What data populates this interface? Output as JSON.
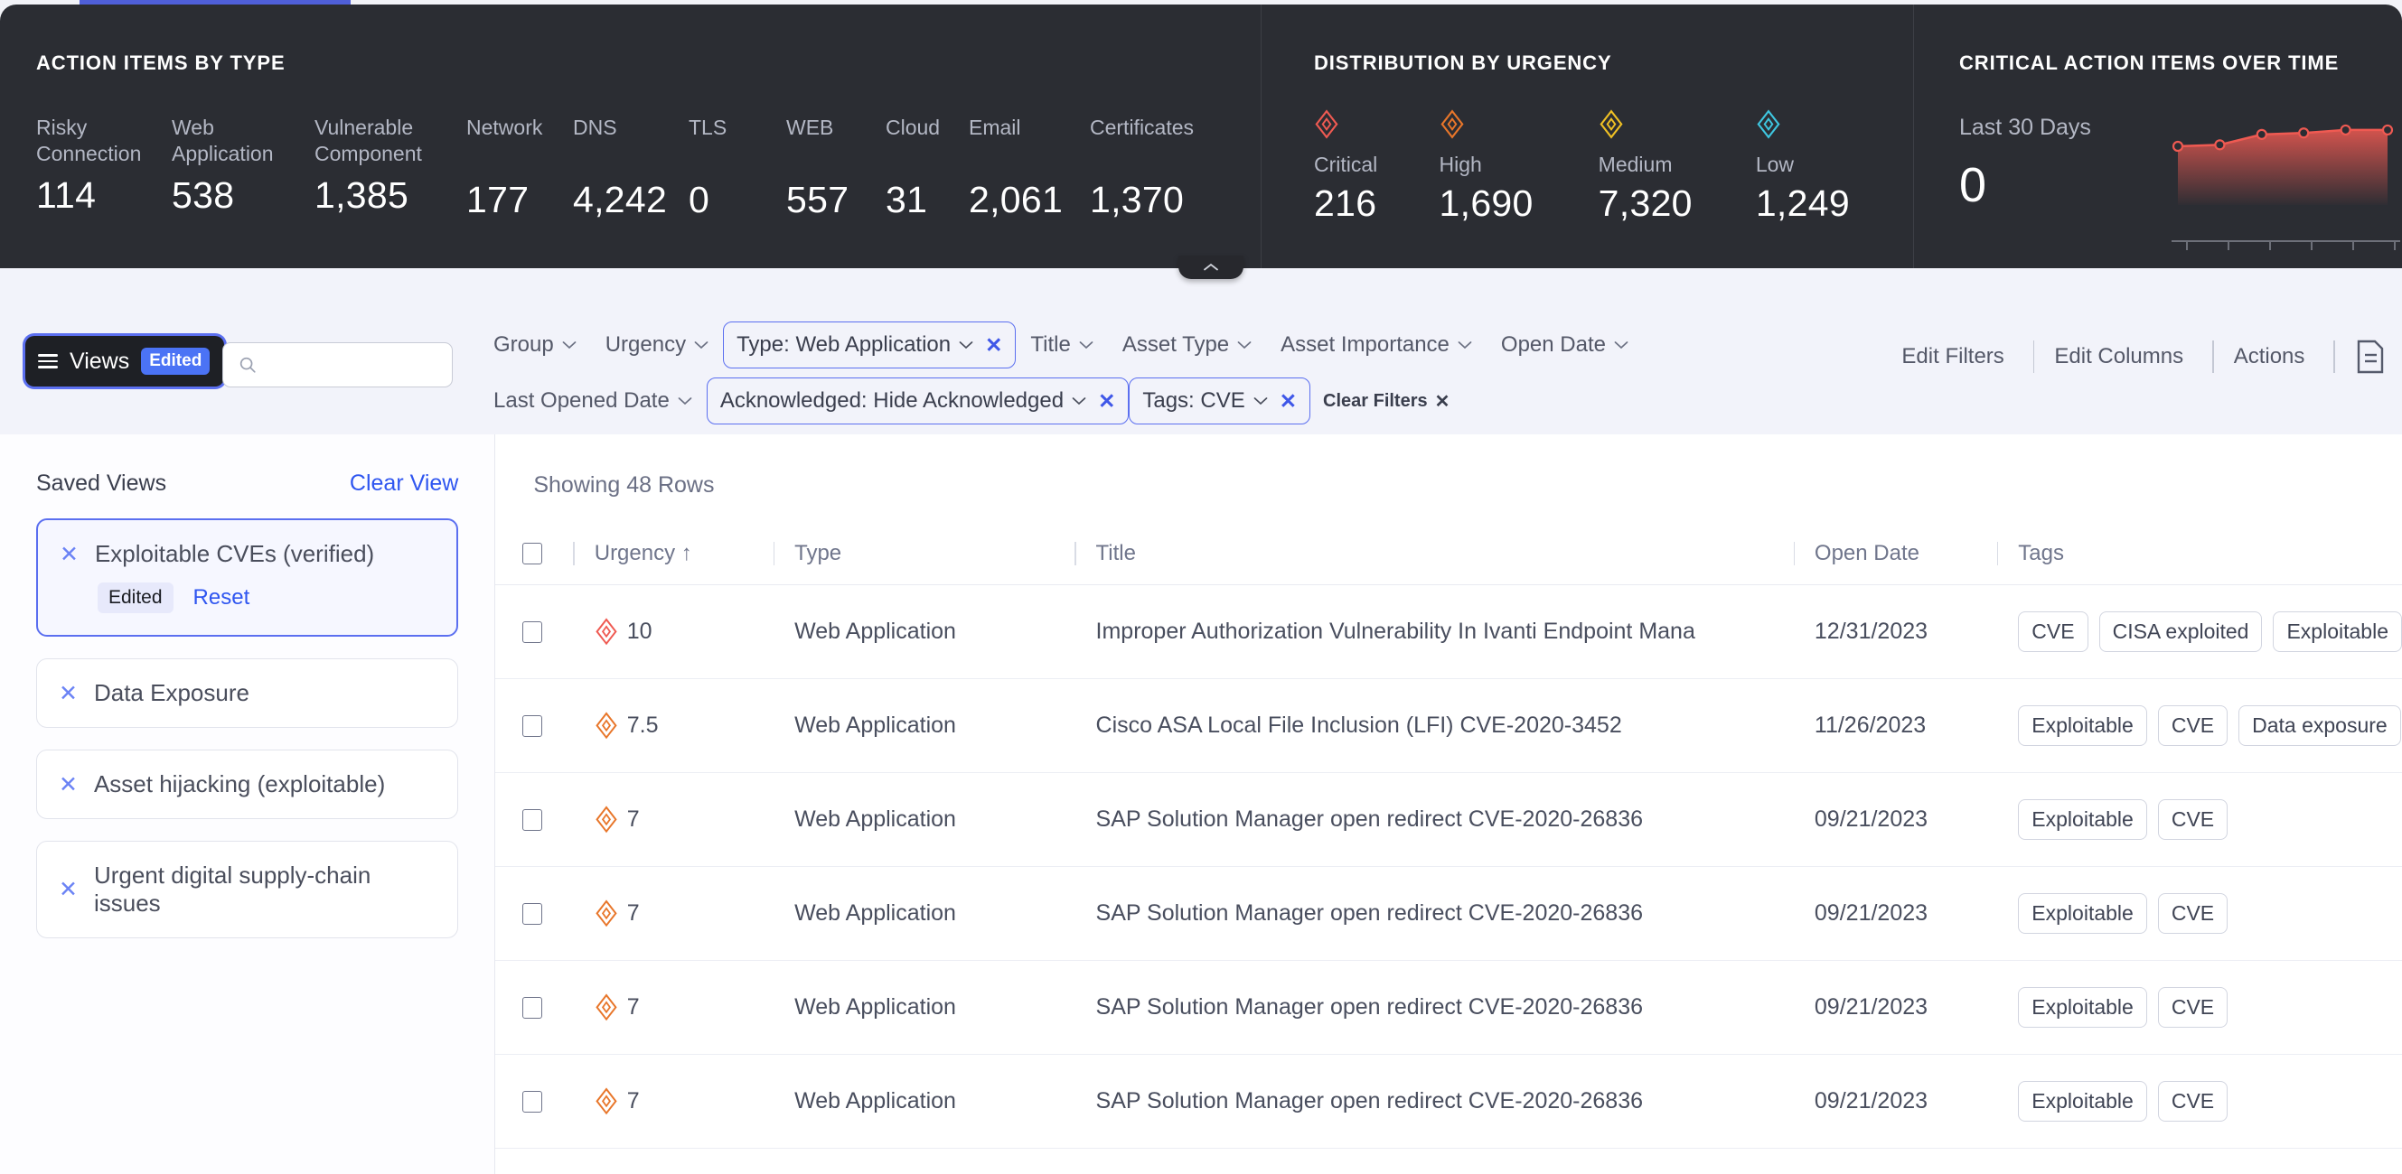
{
  "dashboard": {
    "action_items": {
      "title": "ACTION ITEMS BY TYPE",
      "stats": [
        {
          "label": "Risky\nConnection",
          "value": "114",
          "lines": 2
        },
        {
          "label": "Web\nApplication",
          "value": "538",
          "lines": 2
        },
        {
          "label": "Vulnerable\nComponent",
          "value": "1,385",
          "lines": 2
        },
        {
          "label": "Network",
          "value": "177",
          "lines": 1
        },
        {
          "label": "DNS",
          "value": "4,242",
          "lines": 1
        },
        {
          "label": "TLS",
          "value": "0",
          "lines": 1
        },
        {
          "label": "WEB",
          "value": "557",
          "lines": 1
        },
        {
          "label": "Cloud",
          "value": "31",
          "lines": 1
        },
        {
          "label": "Email",
          "value": "2,061",
          "lines": 1
        },
        {
          "label": "Certificates",
          "value": "1,370",
          "lines": 1
        }
      ]
    },
    "urgency": {
      "title": "DISTRIBUTION BY URGENCY",
      "items": [
        {
          "label": "Critical",
          "value": "216",
          "color": "#ef5a52"
        },
        {
          "label": "High",
          "value": "1,690",
          "color": "#e8762a"
        },
        {
          "label": "Medium",
          "value": "7,320",
          "color": "#efc024"
        },
        {
          "label": "Low",
          "value": "1,249",
          "color": "#3ec6e0"
        }
      ]
    },
    "critical_over_time": {
      "title": "CRITICAL ACTION ITEMS OVER TIME",
      "subtitle": "Last 30 Days",
      "value": "0"
    },
    "collapse_icon": "chevron-up-icon"
  },
  "chart_data": {
    "type": "area",
    "title": "CRITICAL ACTION ITEMS OVER TIME",
    "subtitle": "Last 30 Days",
    "x": [
      1,
      2,
      3,
      4,
      5,
      6
    ],
    "values": [
      205,
      206,
      213,
      214,
      216,
      216
    ],
    "ylabel": "",
    "xlabel": "",
    "grid": false,
    "line_color": "#ef5a52",
    "fill": "gradient-red",
    "ticks": 6
  },
  "toolbar": {
    "views_label": "Views",
    "views_badge": "Edited",
    "search_placeholder": "",
    "search_value": "",
    "filters_row1": [
      {
        "label": "Group",
        "active": false,
        "removable": false
      },
      {
        "label": "Urgency",
        "active": false,
        "removable": false
      },
      {
        "label": "Type: Web Application",
        "active": true,
        "removable": true
      },
      {
        "label": "Title",
        "active": false,
        "removable": false
      },
      {
        "label": "Asset Type",
        "active": false,
        "removable": false
      },
      {
        "label": "Asset Importance",
        "active": false,
        "removable": false
      },
      {
        "label": "Open Date",
        "active": false,
        "removable": false
      }
    ],
    "filters_row2": [
      {
        "label": "Last Opened Date",
        "active": false,
        "removable": false
      },
      {
        "label": "Acknowledged: Hide Acknowledged",
        "active": true,
        "removable": true
      },
      {
        "label": "Tags: CVE",
        "active": true,
        "removable": true
      }
    ],
    "clear_filters": "Clear Filters",
    "right_actions": [
      {
        "label": "Edit Filters"
      },
      {
        "label": "Edit Columns"
      },
      {
        "label": "Actions"
      }
    ],
    "export_icon": "document-export-icon"
  },
  "sidebar": {
    "title": "Saved Views",
    "clear_label": "Clear View",
    "items": [
      {
        "label": "Exploitable CVEs (verified)",
        "selected": true,
        "badge": "Edited",
        "reset": "Reset"
      },
      {
        "label": "Data Exposure",
        "selected": false
      },
      {
        "label": "Asset hijacking (exploitable)",
        "selected": false
      },
      {
        "label": "Urgent digital supply-chain issues",
        "selected": false
      }
    ]
  },
  "table": {
    "showing": "Showing 48 Rows",
    "columns": [
      "Urgency ↑",
      "Type",
      "Title",
      "Open Date",
      "Tags"
    ],
    "rows": [
      {
        "urgency": "10",
        "urgency_color": "#ef5a52",
        "type": "Web Application",
        "title": "Improper Authorization Vulnerability In Ivanti Endpoint Mana",
        "date": "12/31/2023",
        "tags": [
          "CVE",
          "CISA exploited",
          "Exploitable"
        ]
      },
      {
        "urgency": "7.5",
        "urgency_color": "#e8762a",
        "type": "Web Application",
        "title": "Cisco ASA Local File Inclusion (LFI) CVE-2020-3452",
        "date": "11/26/2023",
        "tags": [
          "Exploitable",
          "CVE",
          "Data exposure"
        ]
      },
      {
        "urgency": "7",
        "urgency_color": "#e8762a",
        "type": "Web Application",
        "title": "SAP Solution Manager open redirect CVE-2020-26836",
        "date": "09/21/2023",
        "tags": [
          "Exploitable",
          "CVE"
        ]
      },
      {
        "urgency": "7",
        "urgency_color": "#e8762a",
        "type": "Web Application",
        "title": "SAP Solution Manager open redirect CVE-2020-26836",
        "date": "09/21/2023",
        "tags": [
          "Exploitable",
          "CVE"
        ]
      },
      {
        "urgency": "7",
        "urgency_color": "#e8762a",
        "type": "Web Application",
        "title": "SAP Solution Manager open redirect CVE-2020-26836",
        "date": "09/21/2023",
        "tags": [
          "Exploitable",
          "CVE"
        ]
      },
      {
        "urgency": "7",
        "urgency_color": "#e8762a",
        "type": "Web Application",
        "title": "SAP Solution Manager open redirect CVE-2020-26836",
        "date": "09/21/2023",
        "tags": [
          "Exploitable",
          "CVE"
        ]
      }
    ]
  }
}
